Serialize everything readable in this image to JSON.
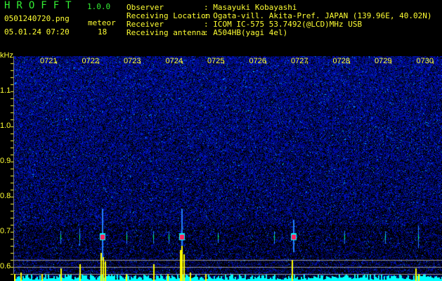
{
  "header": {
    "app_name": "HROFFT",
    "version": "1.0.0",
    "filename": "0501240720.png",
    "datetime": "05.01.24 07:20",
    "meteor_label": "meteor",
    "meteor_count": "18"
  },
  "info": [
    {
      "label": "Observer",
      "value": ": Masayuki Kobayashi"
    },
    {
      "label": "Receiving Location",
      "value": ": Ogata-vill. Akita-Pref. JAPAN (139.96E, 40.02N)"
    },
    {
      "label": "Receiver",
      "value": ": ICOM IC-575 53.7492(@LCD)MHz USB"
    },
    {
      "label": "Receiving antenna",
      "value": ": A504HB(yagi 4el)"
    }
  ],
  "axis": {
    "unit": "kHz",
    "freq_labels": [
      "1.1",
      "1.0",
      "0.9",
      "0.8",
      "0.7",
      "0.6"
    ],
    "time_labels": [
      "0721",
      "0722",
      "0723",
      "0724",
      "0725",
      "0726",
      "0727",
      "0728",
      "0729",
      "0730"
    ]
  },
  "colors": {
    "text": "#ffff33",
    "title": "#33ee33",
    "noise": "#1020c0",
    "meteor": "#ff2060",
    "bars": "#ffff00",
    "baseline": "#00ffff"
  }
}
